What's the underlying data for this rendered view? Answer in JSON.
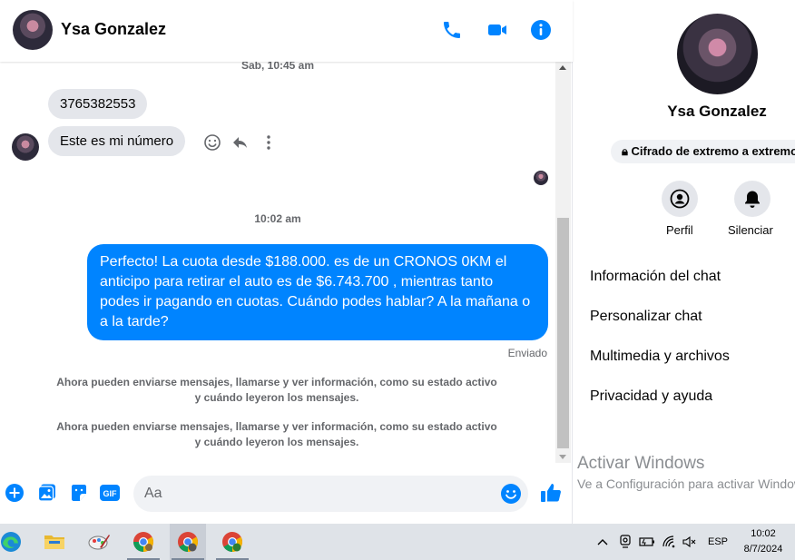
{
  "chat": {
    "contact_name": "Ysa Gonzalez",
    "timestamp_1": "Sab, 10:45 am",
    "msg_in_1": "3765382553",
    "msg_in_2": "Este es mi número",
    "timestamp_2": "10:02 am",
    "msg_out": "Perfecto! La cuota desde $188.000. es de un CRONOS 0KM el anticipo para retirar el auto es de $6.743.700 , mientras tanto podes ir pagando en cuotas. Cuándo podes hablar? A la mañana o a la tarde?",
    "status": "Enviado",
    "system_1": "Ahora pueden enviarse mensajes, llamarse y ver información, como su estado activo y cuándo leyeron los mensajes.",
    "system_2": "Ahora pueden enviarse mensajes, llamarse y ver información, como su estado activo y cuándo leyeron los mensajes.",
    "input_placeholder": "Aa"
  },
  "side": {
    "name": "Ysa Gonzalez",
    "encryption": "Cifrado de extremo a extremo",
    "profile_label": "Perfil",
    "mute_label": "Silenciar",
    "menu": [
      "Información del chat",
      "Personalizar chat",
      "Multimedia y archivos",
      "Privacidad y ayuda"
    ],
    "watermark_title": "Activar Windows",
    "watermark_sub": "Ve a Configuración para activar Windows."
  },
  "taskbar": {
    "lang": "ESP",
    "time": "10:02",
    "date": "8/7/2024"
  },
  "colors": {
    "accent": "#0084ff",
    "incoming_bubble": "#e4e6eb"
  }
}
